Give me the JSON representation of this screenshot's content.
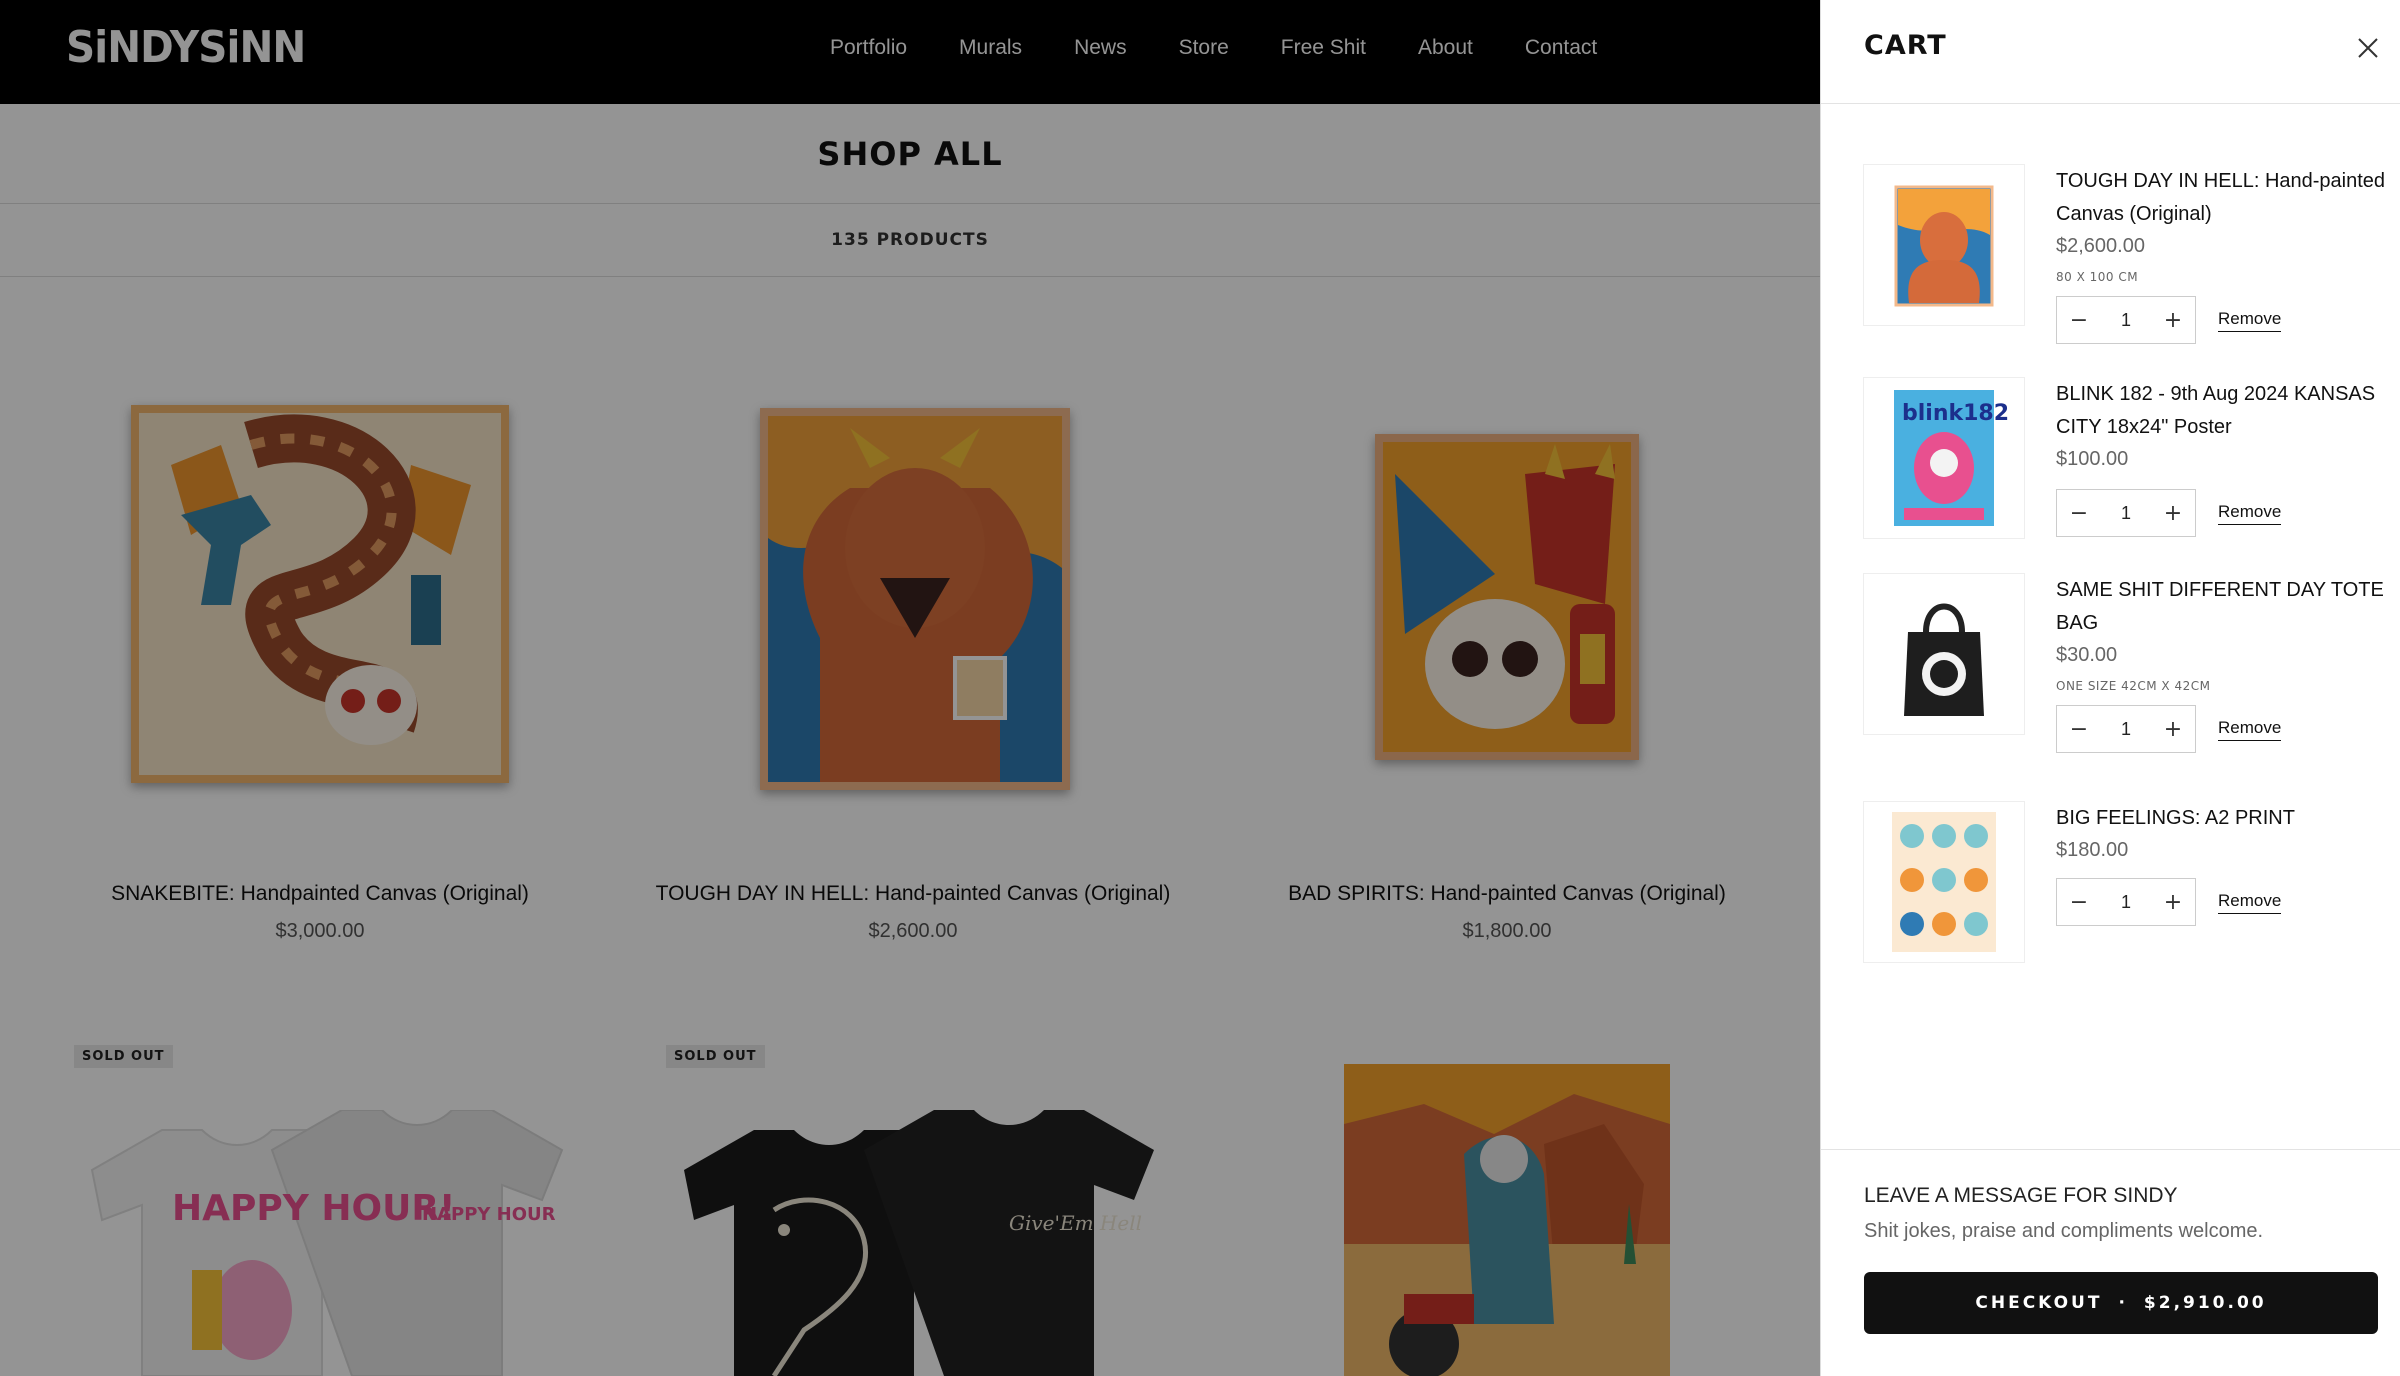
{
  "header": {
    "logo": "SiNDYSiNN",
    "nav": [
      "Portfolio",
      "Murals",
      "News",
      "Store",
      "Free Shit",
      "About",
      "Contact"
    ]
  },
  "page": {
    "title": "SHOP ALL",
    "product_count": "135 PRODUCTS"
  },
  "products": [
    {
      "name": "SNAKEBITE: Handpainted Canvas (Original)",
      "price": "$3,000.00"
    },
    {
      "name": "TOUGH DAY IN HELL: Hand-painted Canvas (Original)",
      "price": "$2,600.00"
    },
    {
      "name": "BAD SPIRITS: Hand-painted Canvas (Original)",
      "price": "$1,800.00"
    }
  ],
  "badges": {
    "sold_out": "SOLD OUT"
  },
  "shirt_text": {
    "happy_hour": "HAPPY HOUR!",
    "happy_hour_small": "HAPPY HOUR",
    "give_em_hell": "Give'Em Hell"
  },
  "cart": {
    "title": "CART",
    "items": [
      {
        "name": "TOUGH DAY IN HELL: Hand-painted Canvas (Original)",
        "price": "$2,600.00",
        "variant": "80 X 100 CM",
        "qty": "1",
        "remove": "Remove"
      },
      {
        "name": "BLINK 182 - 9th Aug 2024 KANSAS CITY 18x24\" Poster",
        "price": "$100.00",
        "variant": "",
        "qty": "1",
        "remove": "Remove",
        "thumb_text": "blink182"
      },
      {
        "name": "SAME SHIT DIFFERENT DAY TOTE BAG",
        "price": "$30.00",
        "variant": "ONE SIZE 42CM X 42CM",
        "qty": "1",
        "remove": "Remove"
      },
      {
        "name": "BIG FEELINGS: A2 PRINT",
        "price": "$180.00",
        "variant": "",
        "qty": "1",
        "remove": "Remove"
      }
    ],
    "message_title": "LEAVE A MESSAGE FOR SINDY",
    "message_sub": "Shit jokes, praise and compliments welcome.",
    "checkout_label": "CHECKOUT",
    "checkout_total": "$2,910.00"
  },
  "colors": {
    "overlay": "rgba(0,0,0,0.42)",
    "header": "#000000",
    "checkout": "#111111"
  }
}
